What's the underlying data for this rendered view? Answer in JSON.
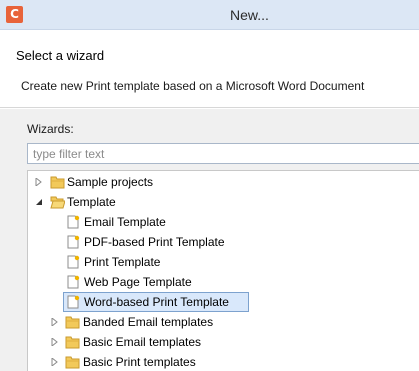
{
  "window": {
    "title": "New...",
    "app_icon_letter": "C",
    "app_icon_color": "#e8633a"
  },
  "header": {
    "heading": "Select a wizard",
    "description": "Create new Print template based on a Microsoft Word Document"
  },
  "wizards": {
    "label": "Wizards:",
    "filter_placeholder": "type filter text"
  },
  "tree": {
    "items": [
      {
        "label": "Sample projects",
        "icon": "folder-icon",
        "expanded": false
      },
      {
        "label": "Template",
        "icon": "folder-icon",
        "expanded": true
      },
      {
        "label": "Email Template",
        "icon": "template-file-icon"
      },
      {
        "label": "PDF-based Print Template",
        "icon": "template-file-icon"
      },
      {
        "label": "Print Template",
        "icon": "template-file-icon"
      },
      {
        "label": "Web Page Template",
        "icon": "template-file-icon"
      },
      {
        "label": "Word-based Print Template",
        "icon": "template-file-icon",
        "selected": true
      },
      {
        "label": "Banded Email templates",
        "icon": "folder-icon",
        "expanded": false
      },
      {
        "label": "Basic Email templates",
        "icon": "folder-icon",
        "expanded": false
      },
      {
        "label": "Basic Print templates",
        "icon": "folder-icon",
        "expanded": false
      }
    ]
  }
}
